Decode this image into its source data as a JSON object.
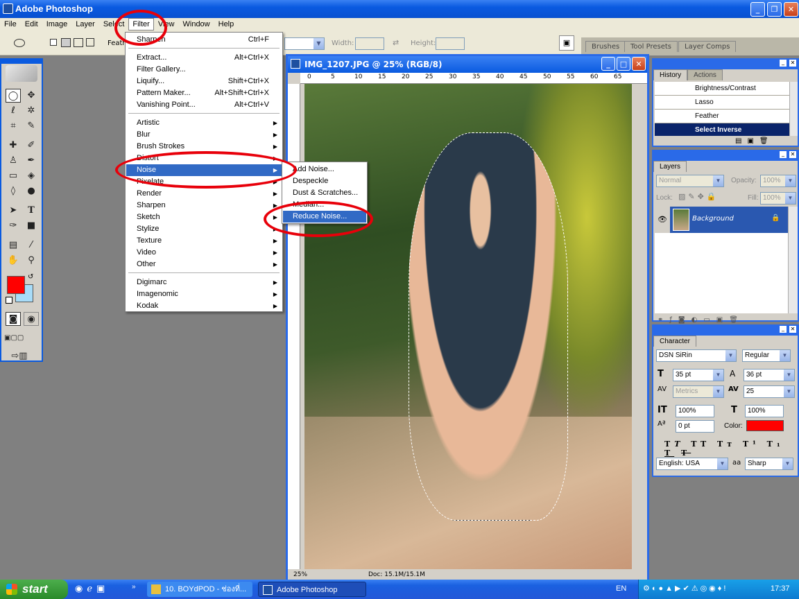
{
  "app": {
    "title": "Adobe Photoshop"
  },
  "menubar": [
    "File",
    "Edit",
    "Image",
    "Layer",
    "Select",
    "Filter",
    "View",
    "Window",
    "Help"
  ],
  "options": {
    "feather_label": "Feath",
    "width_label": "Width:",
    "height_label": "Height:"
  },
  "panel_well_tabs": [
    "Brushes",
    "Tool Presets",
    "Layer Comps"
  ],
  "filter_menu": {
    "top": [
      {
        "label": "Sharpen",
        "shortcut": "Ctrl+F"
      }
    ],
    "group1": [
      {
        "label": "Extract...",
        "shortcut": "Alt+Ctrl+X"
      },
      {
        "label": "Filter Gallery...",
        "shortcut": ""
      },
      {
        "label": "Liquify...",
        "shortcut": "Shift+Ctrl+X"
      },
      {
        "label": "Pattern Maker...",
        "shortcut": "Alt+Shift+Ctrl+X"
      },
      {
        "label": "Vanishing Point...",
        "shortcut": "Alt+Ctrl+V"
      }
    ],
    "group2": [
      "Artistic",
      "Blur",
      "Brush Strokes",
      "Distort",
      "Noise",
      "Pixelate",
      "Render",
      "Sharpen",
      "Sketch",
      "Stylize",
      "Texture",
      "Video",
      "Other"
    ],
    "group3": [
      "Digimarc",
      "Imagenomic",
      "Kodak"
    ],
    "highlighted": "Noise"
  },
  "noise_submenu": [
    "Add Noise...",
    "Despeckle",
    "Dust & Scratches...",
    "Median...",
    "Reduce Noise..."
  ],
  "document": {
    "title": "IMG_1207.JPG @ 25% (RGB/8)",
    "ruler": [
      "0",
      "5",
      "10",
      "15",
      "20",
      "25",
      "30",
      "35",
      "40",
      "45",
      "50",
      "55",
      "60",
      "65"
    ],
    "zoom": "25%",
    "doc_info": "Doc: 15.1M/15.1M"
  },
  "history": {
    "tabs": [
      "History",
      "Actions"
    ],
    "items": [
      "Brightness/Contrast",
      "Lasso",
      "Feather",
      "Select Inverse"
    ]
  },
  "layers": {
    "tab": "Layers",
    "blend": "Normal",
    "opacity_label": "Opacity:",
    "opacity": "100%",
    "lock_label": "Lock:",
    "fill_label": "Fill:",
    "fill": "100%",
    "layer_name": "Background"
  },
  "character": {
    "tab": "Character",
    "font": "DSN SiRin",
    "style": "Regular",
    "size": "35 pt",
    "leading": "36 pt",
    "kerning": "Metrics",
    "tracking": "25",
    "vscale": "100%",
    "hscale": "100%",
    "baseline": "0 pt",
    "color_label": "Color:",
    "language": "English: USA",
    "aa_label": "a",
    "antialias": "Sharp",
    "color": "#ff0000"
  },
  "toolbox": {
    "fg_color": "#ff0000",
    "bg_color": "#a8dcf8"
  },
  "taskbar": {
    "start": "start",
    "tasks": [
      "10. BOYdPOD - ช่องที่...",
      "Adobe Photoshop"
    ],
    "lang": "EN",
    "clock": "17:37"
  }
}
